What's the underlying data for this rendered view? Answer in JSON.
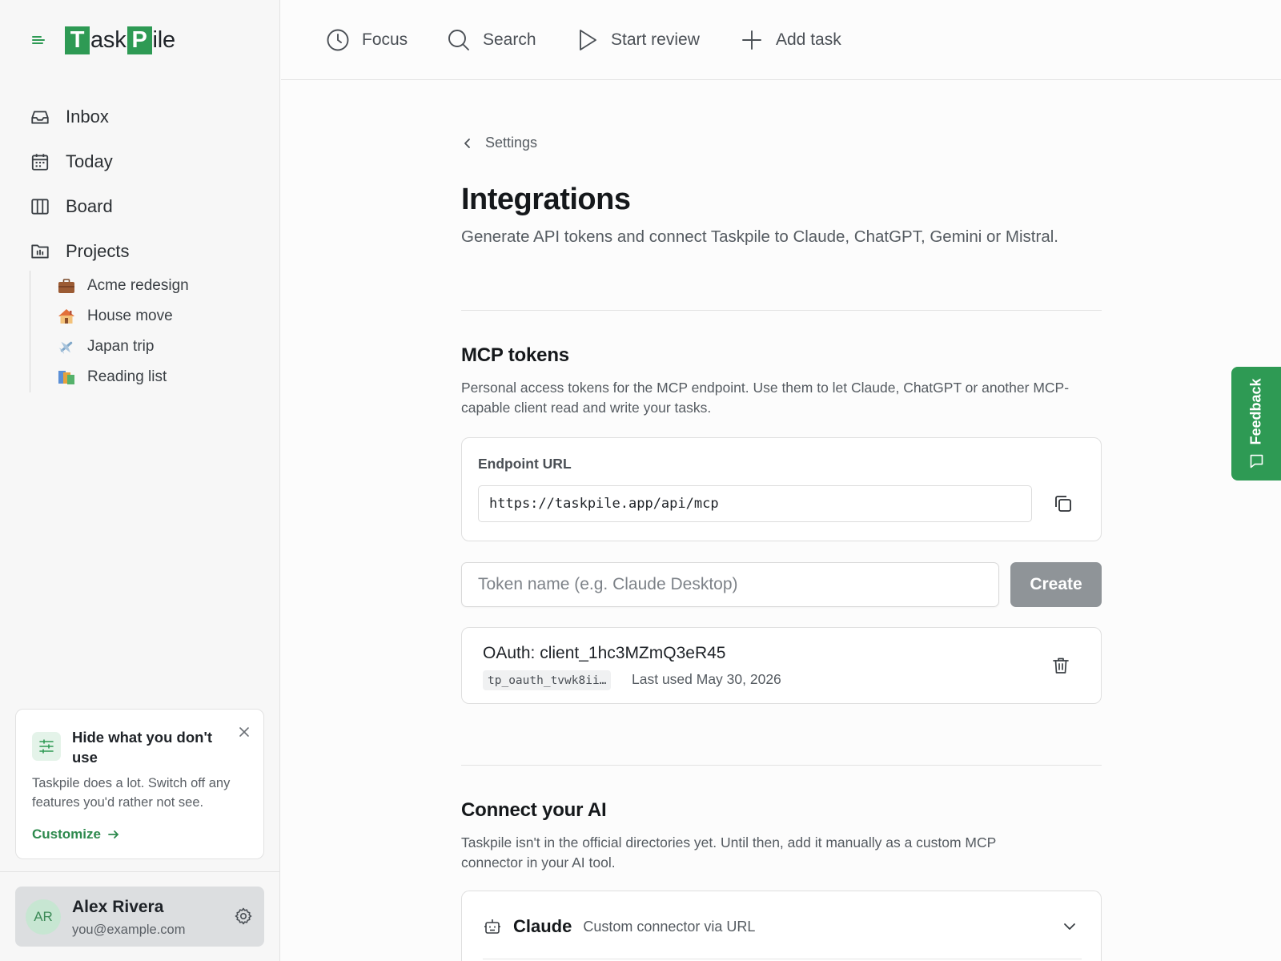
{
  "app": {
    "name_parts": [
      "T",
      "ask",
      "P",
      "ile"
    ]
  },
  "sidebar": {
    "nav": [
      {
        "label": "Inbox",
        "icon": "inbox-icon"
      },
      {
        "label": "Today",
        "icon": "calendar-icon"
      },
      {
        "label": "Board",
        "icon": "board-columns-icon"
      },
      {
        "label": "Projects",
        "icon": "projects-folder-icon"
      }
    ],
    "projects": [
      {
        "label": "Acme redesign",
        "icon": "briefcase-icon"
      },
      {
        "label": "House move",
        "icon": "house-icon"
      },
      {
        "label": "Japan trip",
        "icon": "airplane-icon"
      },
      {
        "label": "Reading list",
        "icon": "books-icon"
      }
    ],
    "promo": {
      "title": "Hide what you don't use",
      "body": "Taskpile does a lot. Switch off any features you'd rather not see.",
      "cta": "Customize"
    },
    "user": {
      "initials": "AR",
      "name": "Alex Rivera",
      "email": "you@example.com"
    }
  },
  "topbar": {
    "focus": "Focus",
    "search": "Search",
    "start_review": "Start review",
    "add_task": "Add task"
  },
  "page": {
    "breadcrumb": "Settings",
    "title": "Integrations",
    "subtitle": "Generate API tokens and connect Taskpile to Claude, ChatGPT, Gemini or Mistral."
  },
  "mcp": {
    "title": "MCP tokens",
    "description": "Personal access tokens for the MCP endpoint. Use them to let Claude, ChatGPT or another MCP-capable client read and write your tasks.",
    "endpoint_label": "Endpoint URL",
    "endpoint_url": "https://taskpile.app/api/mcp",
    "token_placeholder": "Token name (e.g. Claude Desktop)",
    "create_label": "Create",
    "tokens": [
      {
        "name": "OAuth: client_1hc3MZmQ3eR45",
        "prefix": "tp_oauth_tvwk8ii…",
        "last_used": "Last used May 30, 2026"
      }
    ]
  },
  "connect": {
    "title": "Connect your AI",
    "description": "Taskpile isn't in the official directories yet. Until then, add it manually as a custom MCP connector in your AI tool.",
    "providers": [
      {
        "name": "Claude",
        "sub": "Custom connector via URL"
      }
    ]
  },
  "feedback": {
    "label": "Feedback"
  },
  "colors": {
    "brand_green": "#2e9a54",
    "button_disabled": "#8f9498"
  }
}
